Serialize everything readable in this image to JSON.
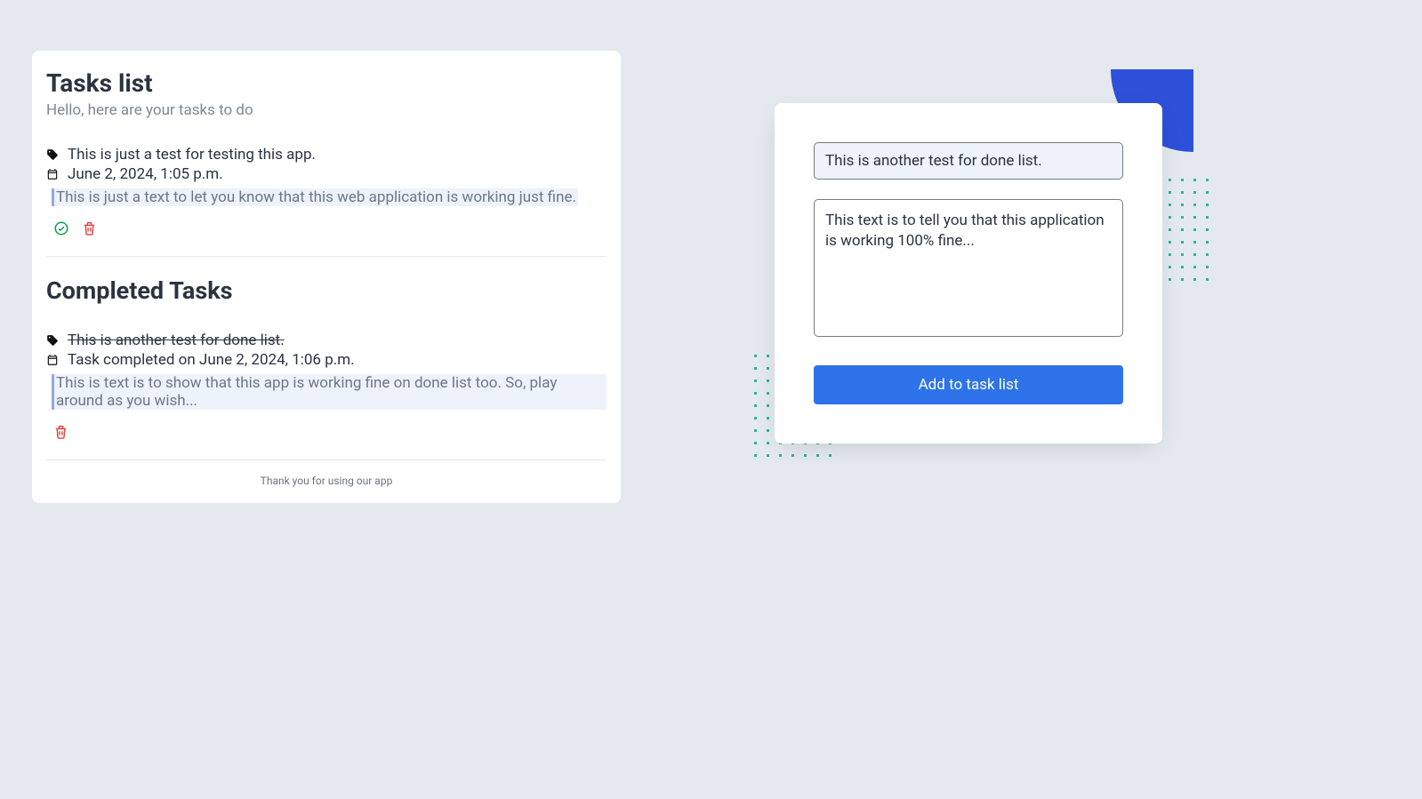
{
  "tasks_list": {
    "title": "Tasks list",
    "subtitle": "Hello, here are your tasks to do",
    "completed_heading": "Completed Tasks",
    "footer": "Thank you for using our app"
  },
  "pending_task": {
    "title": "This is just a test for testing this app.",
    "date": "June 2, 2024, 1:05 p.m.",
    "note": "This is just a text to let you know that this web application is working just fine."
  },
  "completed_task": {
    "title": "This is another test for done list.",
    "date_line": "Task completed on June 2, 2024, 1:06 p.m.",
    "note": "This is text is to show that this app is working fine on done list too. So, play around as you wish..."
  },
  "form": {
    "title_value": "This is another test for done list.",
    "description_value": "This text is to tell you that this application is working 100% fine...",
    "submit_label": "Add to task list"
  }
}
